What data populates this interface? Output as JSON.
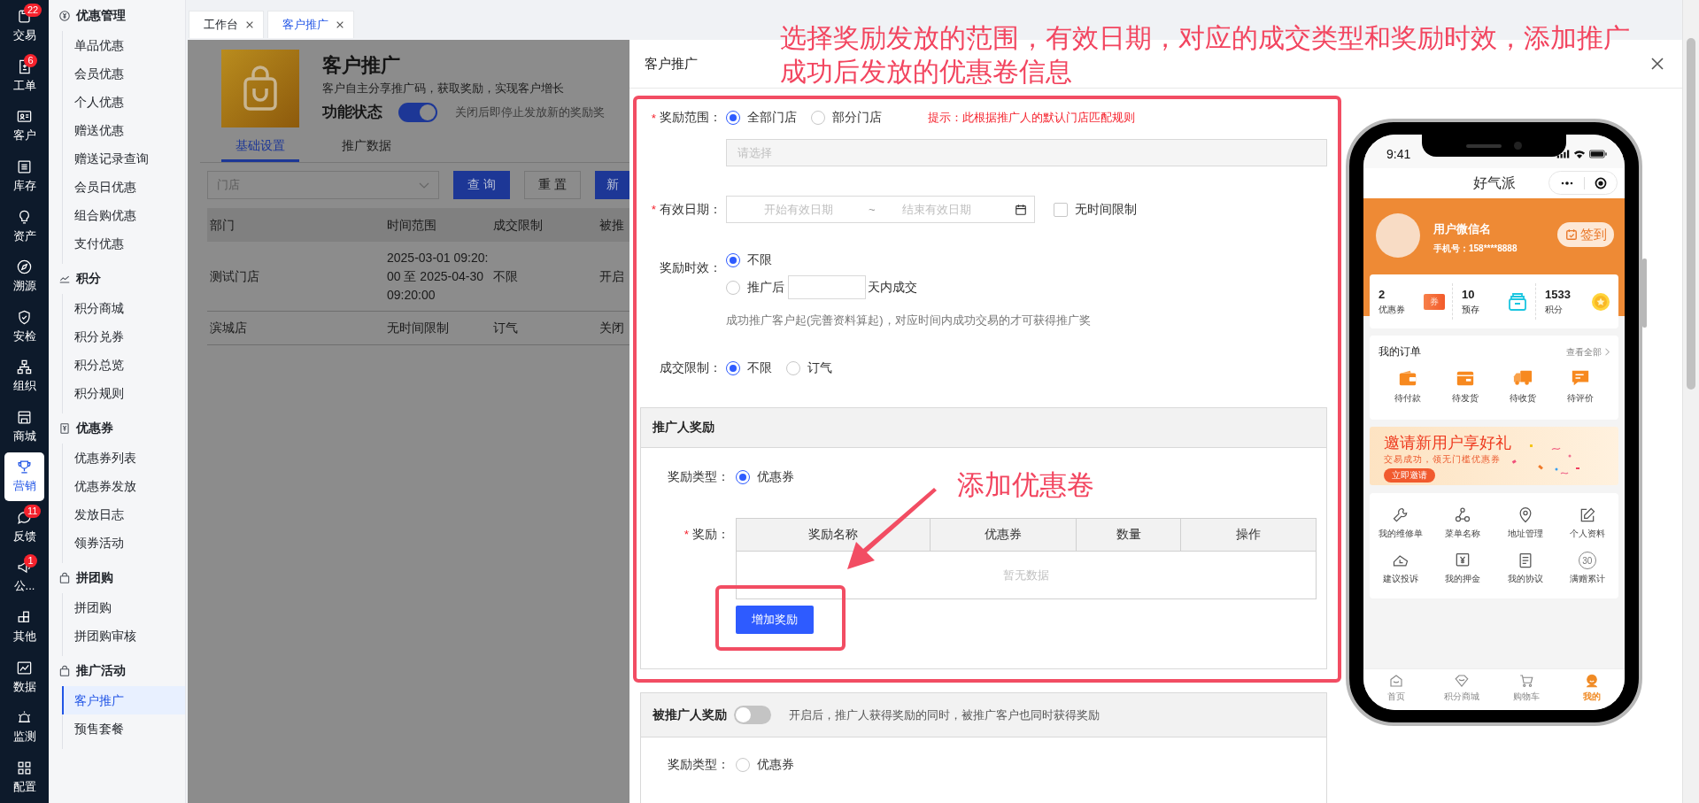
{
  "nav_rail": {
    "items": [
      {
        "label": "交易",
        "badge": "22",
        "selected": false
      },
      {
        "label": "工单",
        "badge": "6",
        "selected": false
      },
      {
        "label": "客户",
        "selected": false
      },
      {
        "label": "库存",
        "selected": false
      },
      {
        "label": "资产",
        "selected": false
      },
      {
        "label": "溯源",
        "selected": false
      },
      {
        "label": "安检",
        "selected": false
      },
      {
        "label": "组织",
        "selected": false
      },
      {
        "label": "商城",
        "selected": false
      },
      {
        "label": "营销",
        "selected": true
      },
      {
        "label": "反馈",
        "badge": "11",
        "selected": false
      },
      {
        "label": "公...",
        "badge": "1",
        "selected": false
      },
      {
        "label": "其他",
        "selected": false
      },
      {
        "label": "数据",
        "selected": false
      },
      {
        "label": "监测",
        "selected": false
      },
      {
        "label": "配置",
        "selected": false
      }
    ]
  },
  "sidebar": {
    "groups": [
      {
        "title": "优惠管理",
        "items": [
          {
            "label": "单品优惠",
            "selected": false
          },
          {
            "label": "会员优惠",
            "selected": false
          },
          {
            "label": "个人优惠",
            "selected": false
          },
          {
            "label": "赠送优惠",
            "selected": false
          },
          {
            "label": "赠送记录查询",
            "selected": false
          },
          {
            "label": "会员日优惠",
            "selected": false
          },
          {
            "label": "组合购优惠",
            "selected": false
          },
          {
            "label": "支付优惠",
            "selected": false
          }
        ]
      },
      {
        "title": "积分",
        "items": [
          {
            "label": "积分商城",
            "selected": false
          },
          {
            "label": "积分兑券",
            "selected": false
          },
          {
            "label": "积分总览",
            "selected": false
          },
          {
            "label": "积分规则",
            "selected": false
          }
        ]
      },
      {
        "title": "优惠券",
        "items": [
          {
            "label": "优惠券列表",
            "selected": false
          },
          {
            "label": "优惠券发放",
            "selected": false
          },
          {
            "label": "发放日志",
            "selected": false
          },
          {
            "label": "领券活动",
            "selected": false
          }
        ]
      },
      {
        "title": "拼团购",
        "items": [
          {
            "label": "拼团购",
            "selected": false
          },
          {
            "label": "拼团购审核",
            "selected": false
          }
        ]
      },
      {
        "title": "推广活动",
        "items": [
          {
            "label": "客户推广",
            "selected": true
          },
          {
            "label": "预售套餐",
            "selected": false
          }
        ]
      }
    ]
  },
  "tabs": [
    {
      "label": "工作台",
      "selected": false
    },
    {
      "label": "客户推广",
      "selected": true
    }
  ],
  "page": {
    "title": "客户推广",
    "description": "客户自主分享推广码，获取奖励，实现客户增长",
    "status": {
      "label": "功能状态",
      "on": true,
      "hint": "关闭后即停止发放新的奖励奖"
    },
    "tabs": [
      {
        "label": "基础设置",
        "selected": true
      },
      {
        "label": "推广数据",
        "selected": false
      }
    ],
    "filter": {
      "placeholder": "门店"
    },
    "buttons": [
      {
        "label": "查 询",
        "kind": "primary"
      },
      {
        "label": "重 置",
        "kind": "default"
      },
      {
        "label": "新",
        "kind": "primary"
      }
    ],
    "table": {
      "columns": [
        "部门",
        "时间范围",
        "成交限制",
        "被推"
      ],
      "rows": [
        [
          "测试门店",
          "2025-03-01 09:20:00 至 2025-04-30 09:20:00",
          "不限",
          "开启"
        ],
        [
          "滨城店",
          "无时间限制",
          "订气",
          "关闭"
        ]
      ]
    }
  },
  "drawer": {
    "title": "客户推广",
    "scope": {
      "required_mark": "*",
      "label": "奖励范围：",
      "options": [
        {
          "label": "全部门店",
          "selected": true
        },
        {
          "label": "部分门店",
          "selected": false
        }
      ],
      "tip": "提示：此根据推广人的默认门店匹配规则",
      "select_placeholder": "请选择"
    },
    "validity": {
      "required_mark": "*",
      "label": "有效日期：",
      "start_placeholder": "开始有效日期",
      "separator": "~",
      "end_placeholder": "结束有效日期",
      "no_limit": {
        "label": "无时间限制",
        "checked": false
      }
    },
    "timing": {
      "label": "奖励时效：",
      "options": [
        {
          "label": "不限",
          "selected": true
        },
        {
          "label": "推广后",
          "suffix": "天内成交",
          "selected": false
        }
      ],
      "help": "成功推广客户起(完善资料算起)，对应时间内成功交易的才可获得推广奖"
    },
    "deal_limit": {
      "label": "成交限制：",
      "options": [
        {
          "label": "不限",
          "selected": true
        },
        {
          "label": "订气",
          "selected": false
        }
      ]
    },
    "promoter_reward": {
      "title": "推广人奖励",
      "type_label": "奖励类型：",
      "type_options": [
        {
          "label": "优惠券",
          "selected": true
        }
      ],
      "reward_required_mark": "*",
      "reward_label": "奖励：",
      "columns": [
        "奖励名称",
        "优惠券",
        "数量",
        "操作"
      ],
      "empty_text": "暂无数据",
      "add_button": "增加奖励"
    },
    "promoted_reward": {
      "title": "被推广人奖励",
      "on": false,
      "hint": "开启后，推广人获得奖励的同时，被推广客户也同时获得奖励",
      "type_label": "奖励类型：",
      "type_options": [
        {
          "label": "优惠券",
          "selected": false
        }
      ]
    }
  },
  "phone": {
    "time": "9:41",
    "app_title": "好气派",
    "user": {
      "name": "用户微信名",
      "phone": "手机号：158****8888"
    },
    "checkin": "签到",
    "stats": [
      {
        "value": "2",
        "label": "优惠券",
        "badge": "券"
      },
      {
        "value": "10",
        "label": "预存"
      },
      {
        "value": "1533",
        "label": "积分"
      }
    ],
    "orders": {
      "title": "我的订单",
      "more": "查看全部",
      "items": [
        "待付款",
        "待发货",
        "待收货",
        "待评价"
      ]
    },
    "banner": {
      "title": "邀请新用户享好礼",
      "subtitle": "交易成功，领无门槛优惠券",
      "button": "立即邀请"
    },
    "tools": [
      {
        "label": "我的维修单"
      },
      {
        "label": "菜单名称"
      },
      {
        "label": "地址管理"
      },
      {
        "label": "个人资料"
      },
      {
        "label": "建议投诉"
      },
      {
        "label": "我的押金"
      },
      {
        "label": "我的协议"
      },
      {
        "label": "满赠累计",
        "icon_text": "30"
      }
    ],
    "tabbar": [
      {
        "label": "首页",
        "selected": false
      },
      {
        "label": "积分商城",
        "selected": false
      },
      {
        "label": "购物车",
        "selected": false
      },
      {
        "label": "我的",
        "selected": true
      }
    ]
  },
  "annotations": {
    "headline": "选择奖励发放的范围，有效日期，对应的成交类型和奖励时效，添加推广成功后发放的优惠卷信息",
    "callout": "添加优惠卷"
  }
}
